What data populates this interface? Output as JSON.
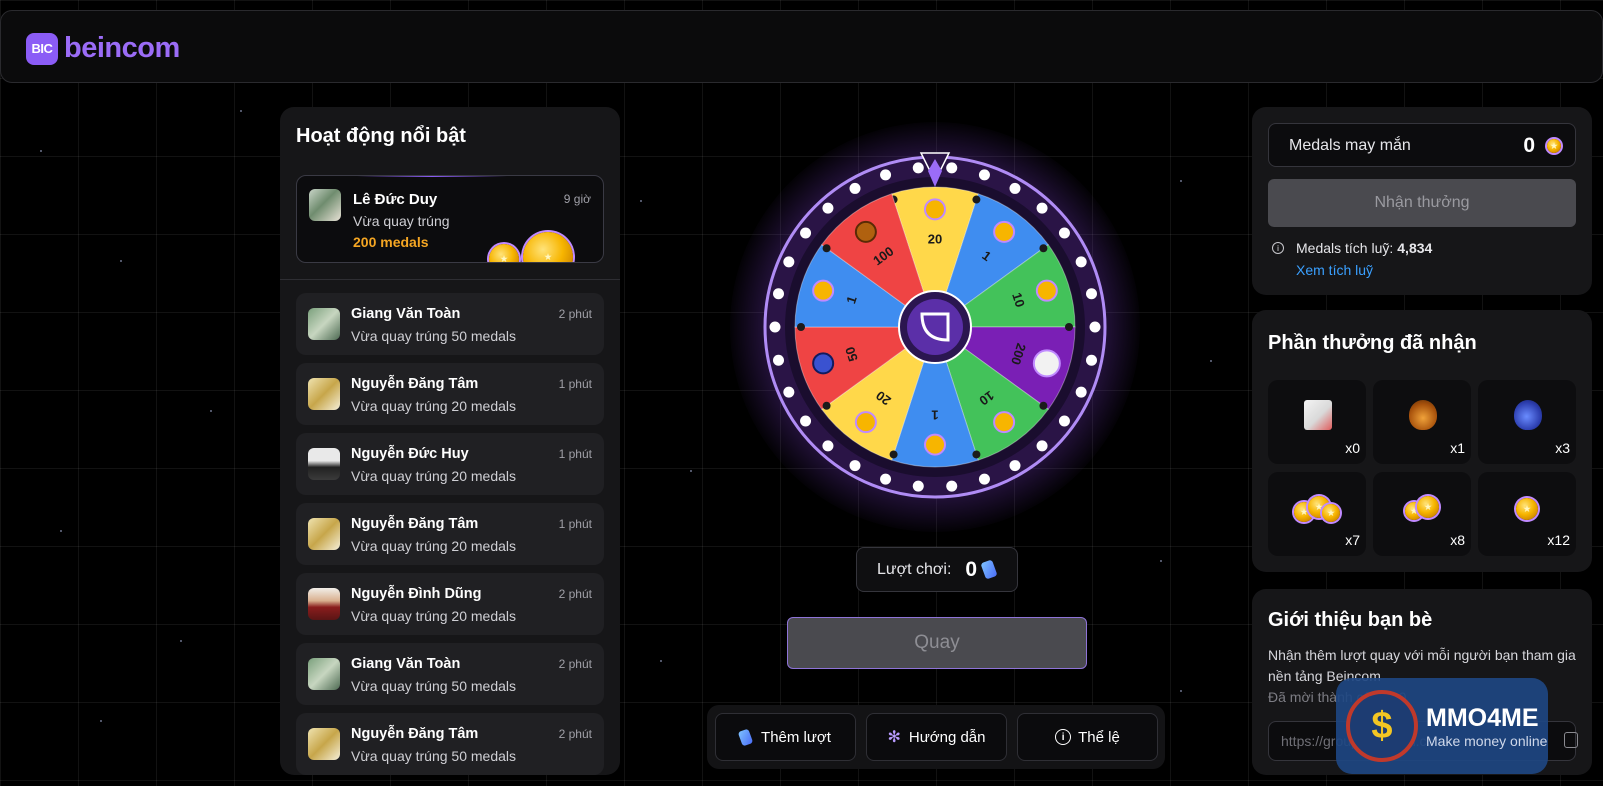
{
  "header": {
    "logo_badge": "BIC",
    "logo_text": "beincom"
  },
  "activity": {
    "title": "Hoạt động nổi bật",
    "featured": {
      "name": "Lê Đức Duy",
      "time": "9 giờ",
      "text": "Vừa quay trúng",
      "amount": "200 medals"
    },
    "items": [
      {
        "name": "Giang Văn Toàn",
        "time": "2 phút",
        "text": "Vừa quay trúng 50 medals"
      },
      {
        "name": "Nguyễn Đăng Tâm",
        "time": "1 phút",
        "text": "Vừa quay trúng 20 medals"
      },
      {
        "name": "Nguyễn Đức Huy",
        "time": "1 phút",
        "text": "Vừa quay trúng 20 medals"
      },
      {
        "name": "Nguyễn Đăng Tâm",
        "time": "1 phút",
        "text": "Vừa quay trúng 20 medals"
      },
      {
        "name": "Nguyễn Đình Dũng",
        "time": "2 phút",
        "text": "Vừa quay trúng 20 medals"
      },
      {
        "name": "Giang Văn Toàn",
        "time": "2 phút",
        "text": "Vừa quay trúng 50 medals"
      },
      {
        "name": "Nguyễn Đăng Tâm",
        "time": "2 phút",
        "text": "Vừa quay trúng 50 medals"
      }
    ]
  },
  "wheel": {
    "segments": [
      {
        "label": "20",
        "color": "#ffd84a",
        "icon": "coin-pile-icon"
      },
      {
        "label": "1",
        "color": "#3f8df0",
        "icon": "coin-icon"
      },
      {
        "label": "10",
        "color": "#43c25a",
        "icon": "coin-pair-icon"
      },
      {
        "label": "200",
        "color": "#7a1fb5",
        "icon": "paper-prize-icon"
      },
      {
        "label": "10",
        "color": "#43c25a",
        "icon": "coin-pair-icon"
      },
      {
        "label": "1",
        "color": "#3f8df0",
        "icon": "coin-icon"
      },
      {
        "label": "20",
        "color": "#ffd84a",
        "icon": "coin-pile-icon"
      },
      {
        "label": "50",
        "color": "#ef4444",
        "icon": "vase-icon"
      },
      {
        "label": "1",
        "color": "#3f8df0",
        "icon": "coin-icon"
      },
      {
        "label": "100",
        "color": "#ef4444",
        "icon": "pot-icon"
      }
    ]
  },
  "plays": {
    "label": "Lượt chơi:",
    "value": "0"
  },
  "spin_button": "Quay",
  "actions": {
    "more": "Thêm lượt",
    "guide": "Hướng dẫn",
    "rules": "Thể lệ"
  },
  "medals": {
    "label": "Medals may mắn",
    "value": "0",
    "claim_button": "Nhận thưởng",
    "accumulated_label": "Medals tích luỹ:",
    "accumulated_value": "4,834",
    "accumulated_link": "Xem tích luỹ"
  },
  "rewards": {
    "title": "Phần thưởng đã nhận",
    "items": [
      {
        "icon": "paper-prize-icon",
        "count": "x0"
      },
      {
        "icon": "pot-icon",
        "count": "x1"
      },
      {
        "icon": "vase-icon",
        "count": "x3"
      },
      {
        "icon": "coin-pile-icon",
        "count": "x7"
      },
      {
        "icon": "coin-pair-icon",
        "count": "x8"
      },
      {
        "icon": "coin-icon",
        "count": "x12"
      }
    ]
  },
  "invite": {
    "title": "Giới thiệu bạn bè",
    "desc": "Nhận thêm lượt quay với mỗi người bạn tham gia nền tảng Beincom",
    "count": "Đã mời thành công 60",
    "link": "https://group.beincom.com"
  },
  "watermark": {
    "title": "MMO4ME",
    "subtitle": "Make money online",
    "symbol": "$"
  },
  "colors": {
    "accent": "#8b5cf6",
    "amount": "#f5a623",
    "link": "#3aa0ff"
  }
}
